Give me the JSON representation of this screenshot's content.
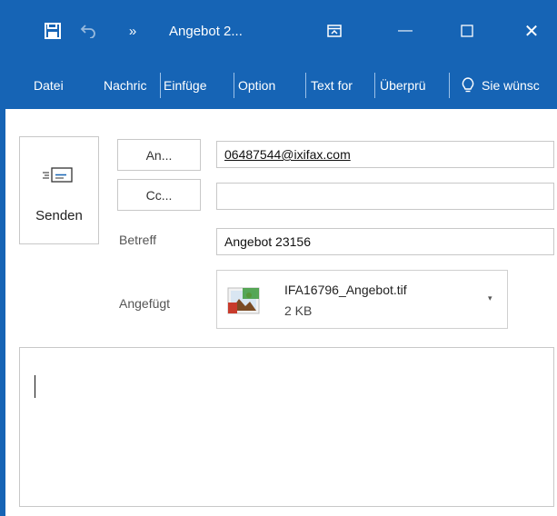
{
  "title_bar": {
    "title": "Angebot 2...",
    "icons": [
      "save-icon",
      "undo-icon",
      "more-commands-icon",
      "ribbon-display-icon",
      "minimize-icon",
      "maximize-icon",
      "close-icon"
    ],
    "more_glyph": "»",
    "minimize_glyph": "—",
    "maximize_glyph": "☐",
    "close_glyph": "✕"
  },
  "ribbon": {
    "tabs": [
      "Datei",
      "Nachric",
      "Einfüge",
      "Option",
      "Text for",
      "Überprü"
    ],
    "tell_me": "Sie wünsc",
    "tell_me_icon": "lightbulb-icon"
  },
  "compose": {
    "send_label": "Senden",
    "send_icon": "send-envelope-icon",
    "to_button": "An...",
    "cc_button": "Cc...",
    "to_value": "06487544@ixifax.com",
    "cc_value": "",
    "subject_label": "Betreff",
    "subject_value": "Angebot 23156",
    "attached_label": "Angefügt",
    "attachment": {
      "name": "IFA16796_Angebot.tif",
      "size": "2 KB",
      "icon": "image-file-icon",
      "caret": "▾"
    },
    "body": ""
  },
  "colors": {
    "accent": "#1664b5",
    "border": "#c8c8c8"
  }
}
